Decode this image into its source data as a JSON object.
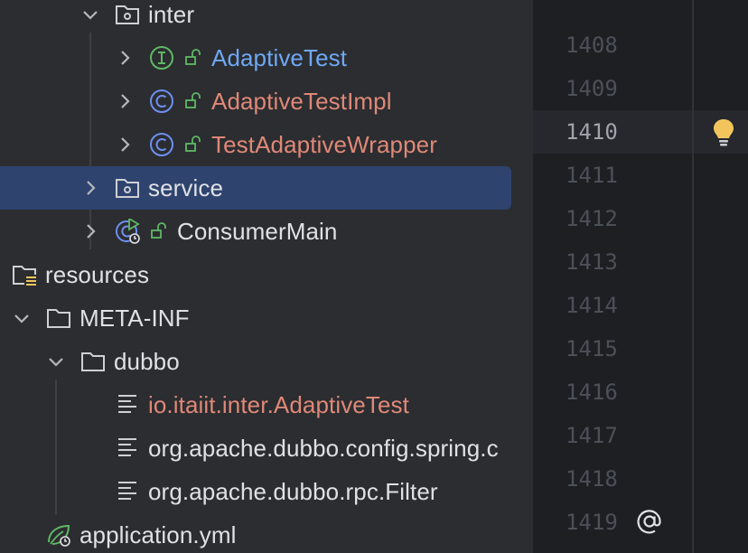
{
  "project_tree": {
    "items": [
      {
        "label": "inter",
        "kind": "package",
        "expanded": true,
        "label_color": "#dfe1e5"
      },
      {
        "label": "AdaptiveTest",
        "kind": "interface",
        "expanded": false,
        "label_color": "#6fa8f5"
      },
      {
        "label": "AdaptiveTestImpl",
        "kind": "class",
        "expanded": false,
        "label_color": "#e08878"
      },
      {
        "label": "TestAdaptiveWrapper",
        "kind": "class",
        "expanded": false,
        "label_color": "#e08878"
      },
      {
        "label": "service",
        "kind": "package",
        "expanded": false,
        "selected": true,
        "label_color": "#dfe1e5"
      },
      {
        "label": "ConsumerMain",
        "kind": "runnable-class",
        "expanded": false,
        "label_color": "#dfe1e5"
      },
      {
        "label": "resources",
        "kind": "resources-folder",
        "label_color": "#dfe1e5"
      },
      {
        "label": "META-INF",
        "kind": "folder",
        "expanded": true,
        "label_color": "#dfe1e5"
      },
      {
        "label": "dubbo",
        "kind": "folder",
        "expanded": true,
        "label_color": "#dfe1e5"
      },
      {
        "label": "io.itaiit.inter.AdaptiveTest",
        "kind": "text-file",
        "label_color": "#e08878"
      },
      {
        "label": "org.apache.dubbo.config.spring.c",
        "kind": "text-file",
        "label_color": "#dfe1e5"
      },
      {
        "label": "org.apache.dubbo.rpc.Filter",
        "kind": "text-file",
        "label_color": "#dfe1e5"
      },
      {
        "label": "application.yml",
        "kind": "spring-config",
        "label_color": "#dfe1e5"
      }
    ]
  },
  "editor": {
    "line_numbers": [
      "1408",
      "1409",
      "1410",
      "1411",
      "1412",
      "1413",
      "1414",
      "1415",
      "1416",
      "1417",
      "1418",
      "1419"
    ],
    "current_line": "1410",
    "intention_icon": "lightbulb-icon",
    "gutter_icon": "at-sign-icon"
  },
  "colors": {
    "tree_background": "#2b2d30",
    "editor_background": "#1e1f22",
    "selection": "#2e436e",
    "interface_green": "#5fb865",
    "class_blue": "#6e8ff0",
    "bulb_yellow": "#f2c55c"
  }
}
